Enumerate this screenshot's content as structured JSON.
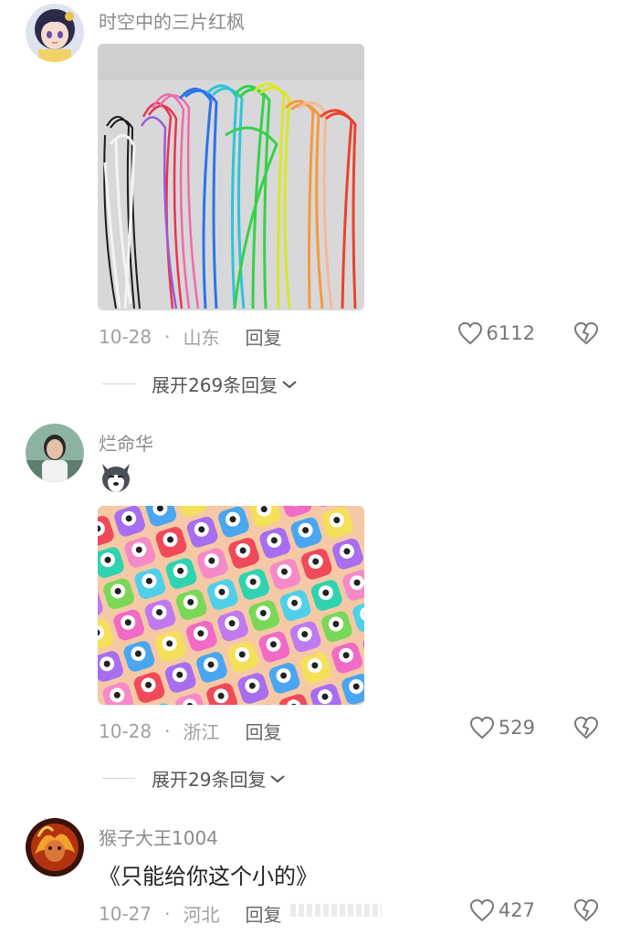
{
  "comments": [
    {
      "username": "时空中的三片红枫",
      "date": "10-28",
      "separator": "·",
      "location": "山东",
      "reply_label": "回复",
      "likes": "6112",
      "expand_label": "展开269条回复",
      "image_desc": "colorful plastic lacing cords"
    },
    {
      "username": "烂命华",
      "sticker": "husky-emoji",
      "date": "10-28",
      "separator": "·",
      "location": "浙江",
      "reply_label": "回复",
      "likes": "529",
      "expand_label": "展开29条回复",
      "image_desc": "colorful paper craft punches"
    },
    {
      "username": "猴子大王1004",
      "text": "《只能给你这个小的》",
      "date": "10-27",
      "separator": "·",
      "location": "河北",
      "reply_label": "回复",
      "likes": "427"
    }
  ],
  "colors": {
    "meta_gray": "#a0a0a0",
    "username_gray": "#8a8a8a",
    "text_dark": "#222222",
    "icon_gray": "#777777"
  },
  "icons": [
    "heart-icon",
    "broken-heart-icon",
    "chevron-down-icon"
  ]
}
